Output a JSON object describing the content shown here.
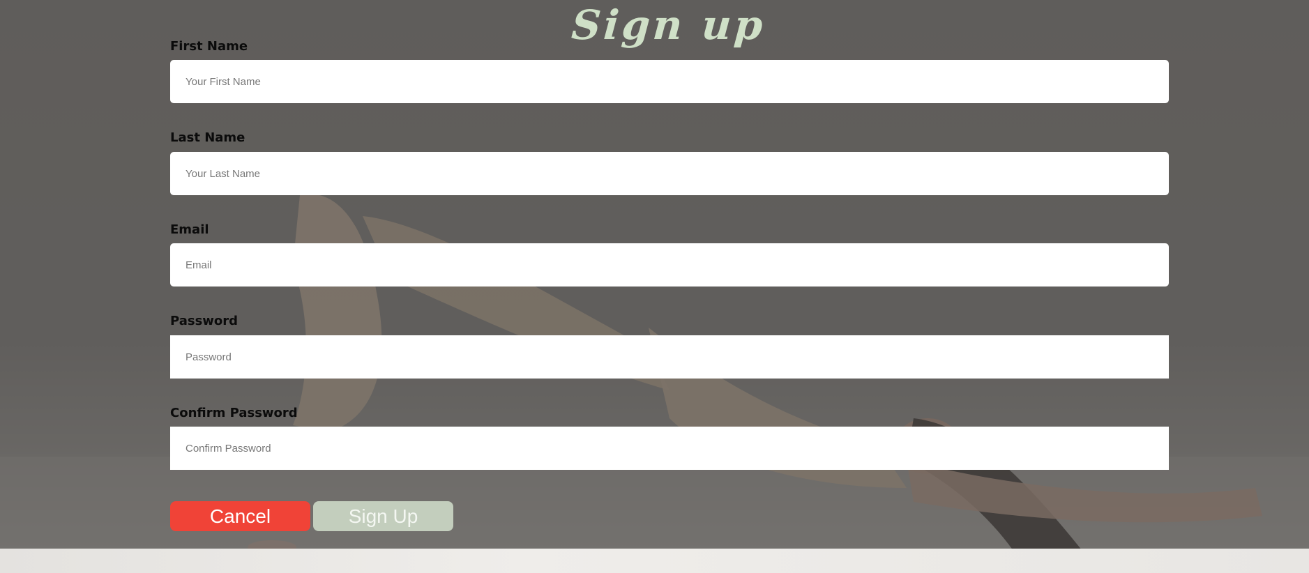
{
  "page": {
    "title": "Sign up"
  },
  "form": {
    "fields": [
      {
        "label": "First Name",
        "placeholder": "Your First Name",
        "value": ""
      },
      {
        "label": "Last Name",
        "placeholder": "Your Last Name",
        "value": ""
      },
      {
        "label": "Email",
        "placeholder": "Email",
        "value": ""
      },
      {
        "label": "Password",
        "placeholder": "Password",
        "value": ""
      },
      {
        "label": "Confirm Password",
        "placeholder": "Confirm Password",
        "value": ""
      }
    ]
  },
  "actions": {
    "cancel_label": "Cancel",
    "signup_label": "Sign Up"
  },
  "colors": {
    "title": "#cfe0c7",
    "cancel": "#f04337",
    "signup": "#c3cebd",
    "overlay": "#464442"
  },
  "background": {
    "description_icon": "yoga-bridge-pose-photo"
  }
}
